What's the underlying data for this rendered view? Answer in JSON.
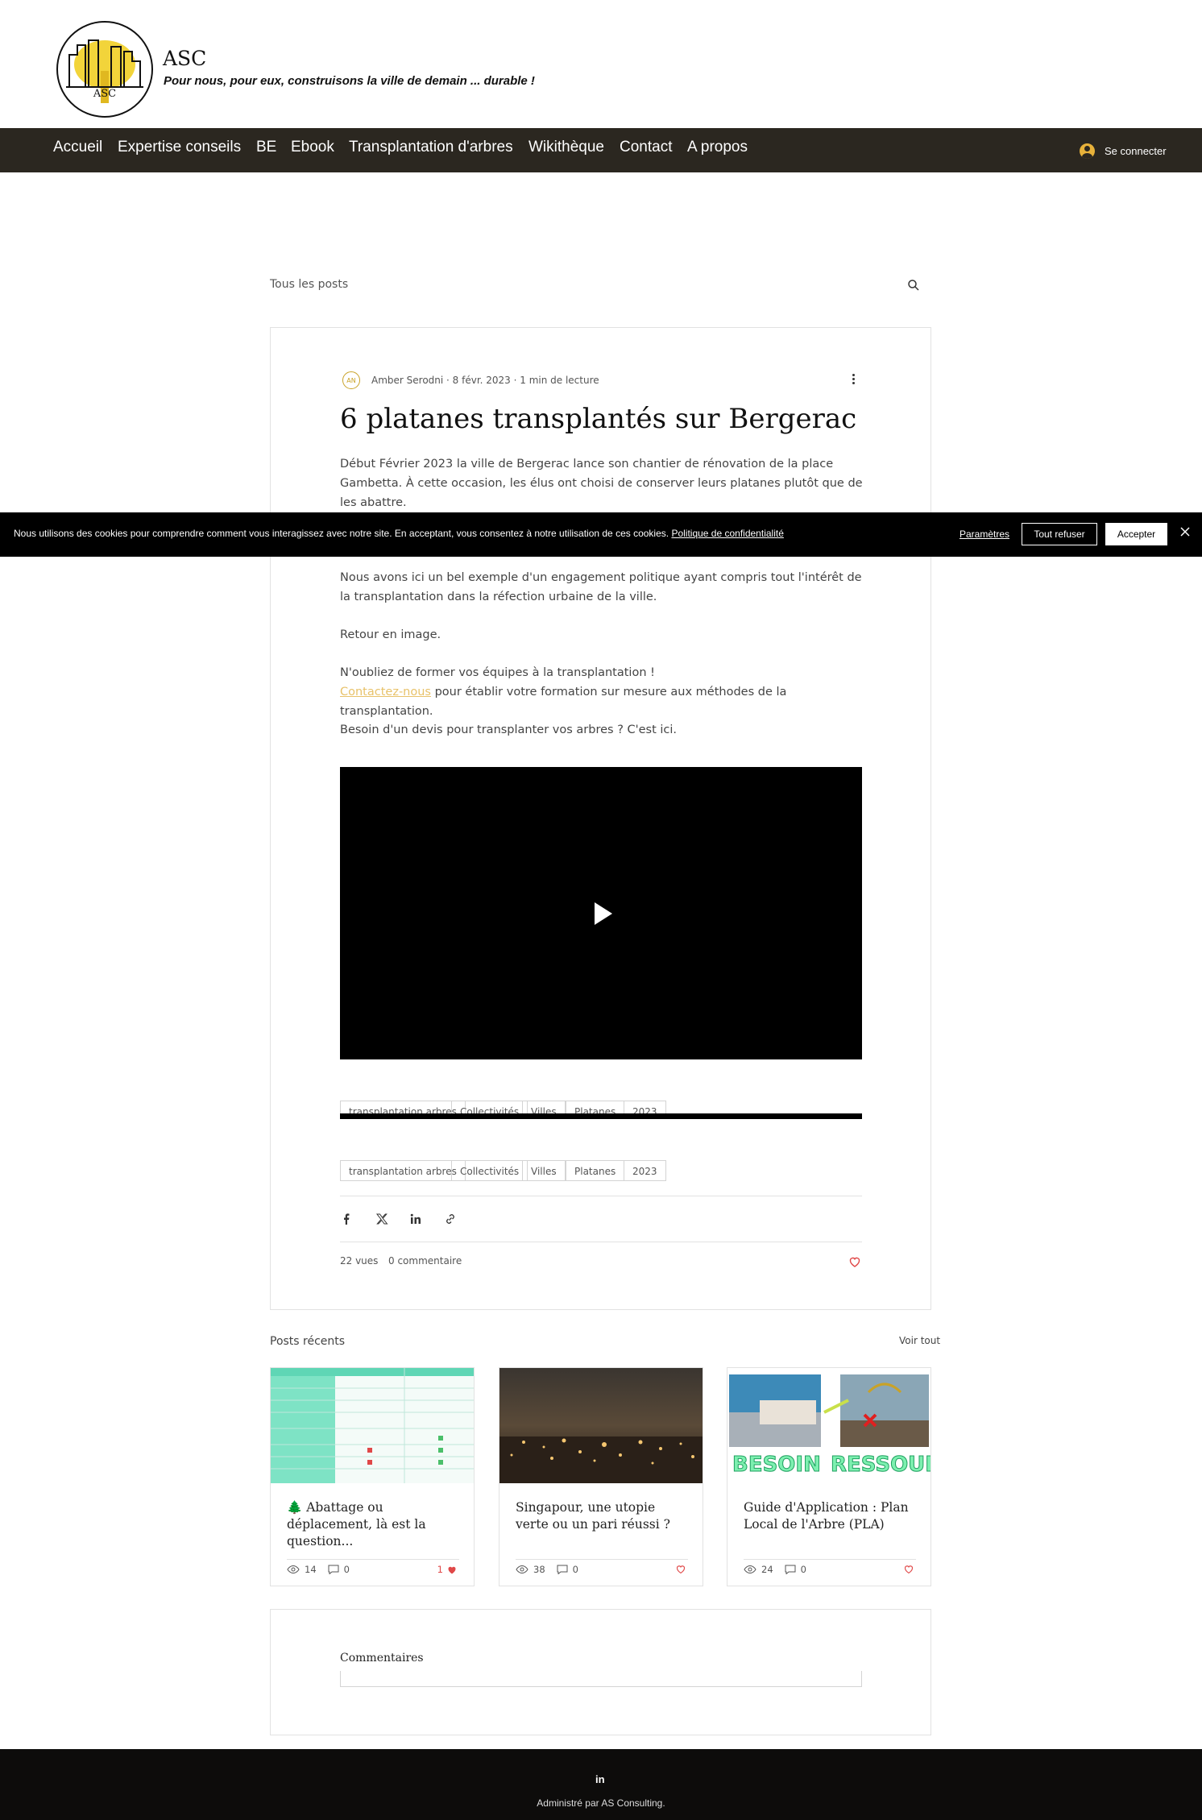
{
  "header": {
    "site_title": "ASC",
    "tagline": "Pour nous, pour eux, construisons la ville de demain ... durable !",
    "logo_text": "ASC"
  },
  "nav": {
    "items": [
      "Accueil",
      "Expertise conseils",
      "BE",
      "Ebook",
      "Transplantation d'arbres",
      "Wikithèque",
      "Contact",
      "A propos"
    ],
    "login_label": "Se connecter"
  },
  "posts_bar": {
    "all_posts_label": "Tous les posts"
  },
  "post": {
    "author_initials": "AN",
    "meta": "Amber Serodni · 8 févr. 2023 · 1 min de lecture",
    "title": "6 platanes transplantés sur Bergerac",
    "intro": "Début Février 2023 la ville de Bergerac lance son chantier de rénovation de la place Gambetta. À cette occasion, les élus ont choisi de conserver leurs platanes plutôt que de les abattre.",
    "paragraph_1": "Nous avons ici un bel exemple d'un engagement politique ayant compris tout l'intérêt de la transplantation dans la réfection urbaine de la ville.",
    "paragraph_2": "Retour en image.",
    "paragraph_3": "N'oubliez de former vos équipes à la transplantation !",
    "contact_link": "Contactez-nous",
    "paragraph_4_rest": " pour établir votre formation sur mesure aux méthodes de la transplantation.",
    "paragraph_5": "Besoin d'un devis pour transplanter vos arbres ? C'est ici.",
    "tags": [
      "transplantation arbres",
      "Collectivités",
      "Villes",
      "Platanes",
      "2023"
    ],
    "views": "22 vues",
    "comments": "0 commentaire"
  },
  "recent": {
    "title": "Posts récents",
    "see_all": "Voir tout",
    "cards": [
      {
        "title": "🌲 Abattage ou déplacement, là est la question...",
        "views": "14",
        "comments": "0",
        "likes": "1"
      },
      {
        "title": "Singapour, une utopie verte ou un pari réussi ?",
        "views": "38",
        "comments": "0",
        "likes": ""
      },
      {
        "title": "Guide d'Application : Plan Local de l'Arbre (PLA)",
        "views": "24",
        "comments": "0",
        "likes": ""
      }
    ],
    "card3_image_words": [
      "BESOIN",
      "RESSOURC"
    ]
  },
  "comments_section": {
    "title": "Commentaires"
  },
  "footer": {
    "social": "in",
    "text": "Administré par AS Consulting."
  },
  "cookie": {
    "text": "Nous utilisons des cookies pour comprendre comment vous interagissez avec notre site. En acceptant, vous consentez à notre utilisation de ces cookies. ",
    "policy_link": "Politique de confidentialité",
    "settings": "Paramètres",
    "refuse": "Tout refuser",
    "accept": "Accepter"
  },
  "colors": {
    "nav_bg": "#2b2720",
    "accent_gold": "#e8b23a",
    "link_gold": "#e8c26a",
    "heart_red": "#e04848",
    "footer_bg": "#0d0c0b"
  }
}
